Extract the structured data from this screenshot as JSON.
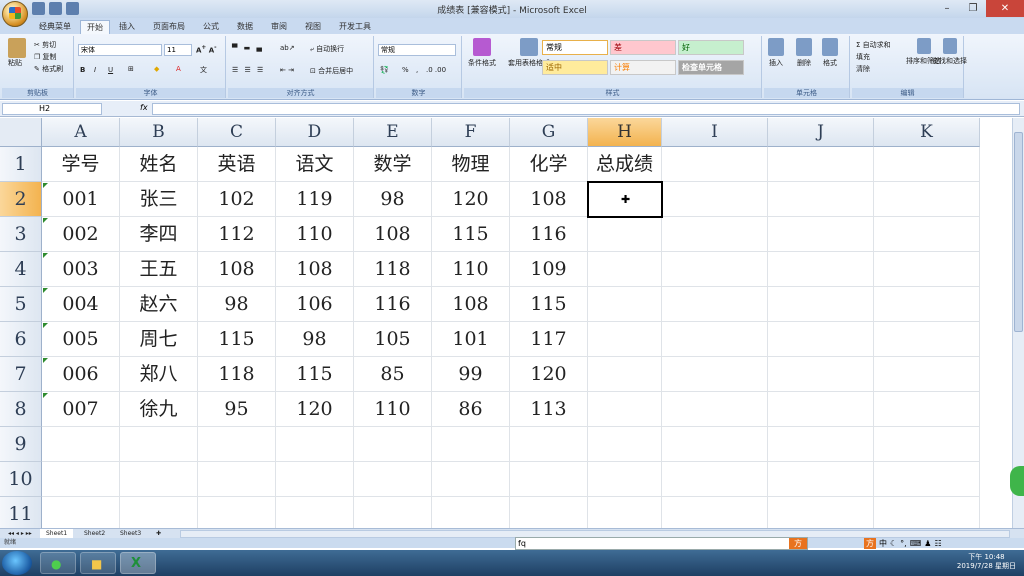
{
  "window": {
    "title": "成绩表 [兼容模式] - Microsoft Excel"
  },
  "ribbon_tabs": [
    "经典菜单",
    "开始",
    "插入",
    "页面布局",
    "公式",
    "数据",
    "审阅",
    "视图",
    "开发工具"
  ],
  "ribbon": {
    "clipboard": {
      "paste": "粘贴",
      "cut": "剪切",
      "copy": "复制",
      "format_painter": "格式刷",
      "label": "剪贴板"
    },
    "font": {
      "name": "宋体",
      "size": "11",
      "bold": "B",
      "italic": "I",
      "underline": "U",
      "label": "字体"
    },
    "alignment": {
      "wrap": "自动换行",
      "merge": "合并后居中",
      "label": "对齐方式"
    },
    "number": {
      "format": "常规",
      "percent": "%",
      "label": "数字"
    },
    "styles": {
      "conditional": "条件格式",
      "table": "套用表格格式",
      "normal": "常规",
      "bad": "差",
      "good": "好",
      "neutral": "适中",
      "calc": "计算",
      "check": "检查单元格",
      "label": "样式"
    },
    "cells": {
      "insert": "插入",
      "delete": "删除",
      "format": "格式",
      "label": "单元格"
    },
    "editing": {
      "autosum": "Σ 自动求和",
      "fill": "填充",
      "clear": "清除",
      "sort": "排序和筛选",
      "find": "查找和选择",
      "label": "编辑"
    }
  },
  "formula_bar": {
    "name_box": "H2",
    "fx": "fx",
    "value": ""
  },
  "columns": [
    "A",
    "B",
    "C",
    "D",
    "E",
    "F",
    "G",
    "H",
    "I",
    "J",
    "K"
  ],
  "rows": [
    "1",
    "2",
    "3",
    "4",
    "5",
    "6",
    "7",
    "8",
    "9",
    "10",
    "11"
  ],
  "selected_cell": "H2",
  "table": {
    "headers": [
      "学号",
      "姓名",
      "英语",
      "语文",
      "数学",
      "物理",
      "化学",
      "总成绩"
    ],
    "records": [
      [
        "001",
        "张三",
        "102",
        "119",
        "98",
        "120",
        "108"
      ],
      [
        "002",
        "李四",
        "112",
        "110",
        "108",
        "115",
        "116"
      ],
      [
        "003",
        "王五",
        "108",
        "108",
        "118",
        "110",
        "109"
      ],
      [
        "004",
        "赵六",
        "98",
        "106",
        "116",
        "108",
        "115"
      ],
      [
        "005",
        "周七",
        "115",
        "98",
        "105",
        "101",
        "117"
      ],
      [
        "006",
        "郑八",
        "118",
        "115",
        "85",
        "99",
        "120"
      ],
      [
        "007",
        "徐九",
        "95",
        "120",
        "110",
        "86",
        "113"
      ]
    ]
  },
  "sheet_tabs": [
    "Sheet1",
    "Sheet2",
    "Sheet3"
  ],
  "status_bar": {
    "text": "就绪"
  },
  "ime": {
    "input": "fq",
    "logo": "方"
  },
  "tray": {
    "lang": "中"
  },
  "clock": {
    "time": "下午 10:48",
    "date": "2019/7/28 星期日"
  },
  "colors": {
    "selection_header": "#f3b34f",
    "active_border": "#000000",
    "ribbon": "#dbe6f4"
  }
}
